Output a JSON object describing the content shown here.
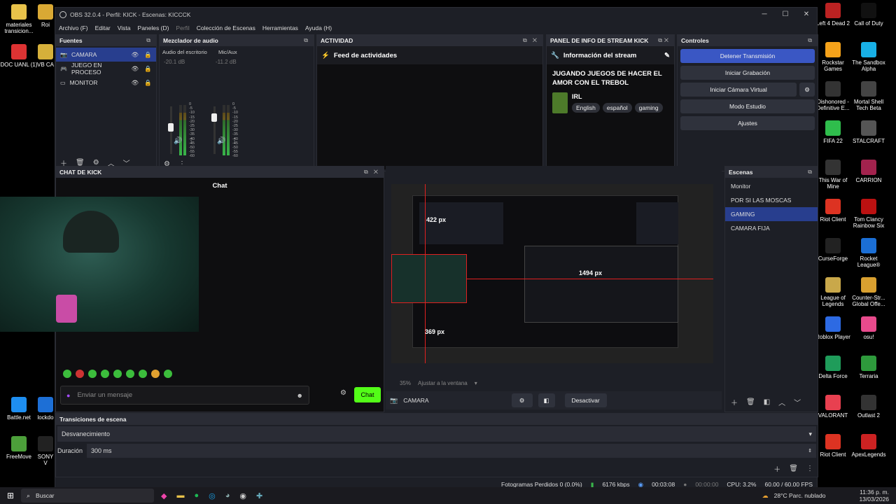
{
  "window": {
    "title": "OBS 32.0.4 - Perfil: KICK - Escenas: KICCCK"
  },
  "menu": [
    "Archivo (F)",
    "Editar",
    "Vista",
    "Paneles (D)",
    "Perfil",
    "Colección de Escenas",
    "Herramientas",
    "Ayuda (H)"
  ],
  "sources": {
    "title": "Fuentes",
    "items": [
      {
        "label": "CAMARA",
        "selected": true,
        "icon": "camera-icon"
      },
      {
        "label": "JUEGO EN PROCESO",
        "selected": false,
        "icon": "gamepad-icon"
      },
      {
        "label": "MONITOR",
        "selected": false,
        "icon": "monitor-icon"
      }
    ]
  },
  "mixer": {
    "title": "Mezclador de audio",
    "channels": [
      {
        "name": "Audio del escritorio",
        "db": "-20.1 dB",
        "level": 0.55
      },
      {
        "name": "Mic/Aux",
        "db": "-11.2 dB",
        "level": 0.75
      }
    ],
    "scale": [
      "0",
      "-5",
      "-10",
      "-15",
      "-20",
      "-25",
      "-30",
      "-35",
      "-40",
      "-45",
      "-50",
      "-55",
      "-60"
    ]
  },
  "activity": {
    "title": "ACTIVIDAD",
    "feed_label": "Feed de actividades"
  },
  "stream_info": {
    "title": "PANEL DE INFO DE STREAM KICK",
    "header": "Información del stream",
    "stream_title": "JUGANDO JUEGOS DE HACER EL AMOR CON EL TREBOL",
    "category": "IRL",
    "tags": [
      "English",
      "español",
      "gaming"
    ]
  },
  "controls": {
    "title": "Controles",
    "buttons": [
      "Detener Transmisión",
      "Iniciar Grabación",
      "Iniciar Cámara Virtual",
      "Modo Estudio",
      "Ajustes"
    ]
  },
  "chat": {
    "dock_title": "CHAT DE KICK",
    "title": "Chat",
    "placeholder": "Enviar un mensaje",
    "send": "Chat"
  },
  "preview": {
    "zoom": "35%",
    "fit": "Ajustar a la ventana",
    "source": "CAMARA",
    "deactivate": "Desactivar",
    "measure_top": "422 px",
    "measure_right": "1494 px",
    "measure_bottom": "369 px"
  },
  "scenes": {
    "title": "Escenas",
    "items": [
      {
        "label": "Monitor",
        "selected": false
      },
      {
        "label": "POR SI LAS MOSCAS",
        "selected": false
      },
      {
        "label": "GAMING",
        "selected": true
      },
      {
        "label": "CAMARA FIJA",
        "selected": false
      }
    ]
  },
  "transitions": {
    "title": "Transiciones de escena",
    "type": "Desvanecimiento",
    "duration_label": "Duración",
    "duration": "300 ms"
  },
  "status": {
    "dropped": "Fotogramas Perdidos 0 (0.0%)",
    "bitrate": "6176 kbps",
    "stream_time": "00:03:08",
    "rec_time": "00:00:00",
    "cpu": "CPU: 3.2%",
    "fps": "60.00 / 60.00 FPS"
  },
  "desktop_left": [
    {
      "label": "materiales transicion...",
      "color": "#e8c24a"
    },
    {
      "label": "DOC UANL (1)",
      "color": "#d33"
    },
    {
      "label": "Battle.net",
      "color": "#1e8ef0"
    },
    {
      "label": "FreeMove",
      "color": "#4c9f3a"
    }
  ],
  "desktop_left2": [
    {
      "label": "Roi",
      "color": "#d9a934"
    },
    {
      "label": "VB CA",
      "color": "#d6b03a"
    },
    {
      "label": "lockdo",
      "color": "#1d6fd6"
    },
    {
      "label": "SONY V",
      "color": "#222"
    }
  ],
  "desktop_right": [
    {
      "label": "Left 4 Dead 2",
      "color": "#b22",
      "col": 0
    },
    {
      "label": "Call of Duty",
      "color": "#111",
      "col": 1
    },
    {
      "label": "Rockstar Games",
      "color": "#f5a21a",
      "col": 0
    },
    {
      "label": "The Sandbox Alpha",
      "color": "#18b0e6",
      "col": 1
    },
    {
      "label": "Dishonored - Definitive E...",
      "color": "#333",
      "col": 0
    },
    {
      "label": "Mortal Shell Tech Beta",
      "color": "#444",
      "col": 1
    },
    {
      "label": "FIFA 22",
      "color": "#2fbd4c",
      "col": 0
    },
    {
      "label": "STALCRAFT",
      "color": "#555",
      "col": 1
    },
    {
      "label": "This War of Mine",
      "color": "#333",
      "col": 0
    },
    {
      "label": "CARRION",
      "color": "#a2224d",
      "col": 1
    },
    {
      "label": "Riot Client",
      "color": "#d32",
      "col": 0
    },
    {
      "label": "Tom Clancy Rainbow Six",
      "color": "#b11",
      "col": 1
    },
    {
      "label": "CurseForge",
      "color": "#222",
      "col": 0
    },
    {
      "label": "Rocket League®",
      "color": "#1b6fd6",
      "col": 1
    },
    {
      "label": "League of Legends",
      "color": "#c9a84a",
      "col": 0
    },
    {
      "label": "Counter-Str... Global Offe...",
      "color": "#d9a030",
      "col": 1
    },
    {
      "label": "Roblox Player",
      "color": "#2d6ae3",
      "col": 0
    },
    {
      "label": "osu!",
      "color": "#e84a8c",
      "col": 1
    },
    {
      "label": "Delta Force",
      "color": "#1f9c5a",
      "col": 0
    },
    {
      "label": "Terraria",
      "color": "#2e9a3c",
      "col": 1
    },
    {
      "label": "VALORANT",
      "color": "#e84050",
      "col": 0
    },
    {
      "label": "Outlast 2",
      "color": "#333",
      "col": 1
    },
    {
      "label": "Riot Client",
      "color": "#d32",
      "col": 0
    },
    {
      "label": "ApexLegends",
      "color": "#c22",
      "col": 1
    }
  ],
  "taskbar": {
    "search": "Buscar",
    "weather": "28°C Parc. nublado",
    "time": "11:36 p. m.",
    "date": "13/03/2026"
  }
}
